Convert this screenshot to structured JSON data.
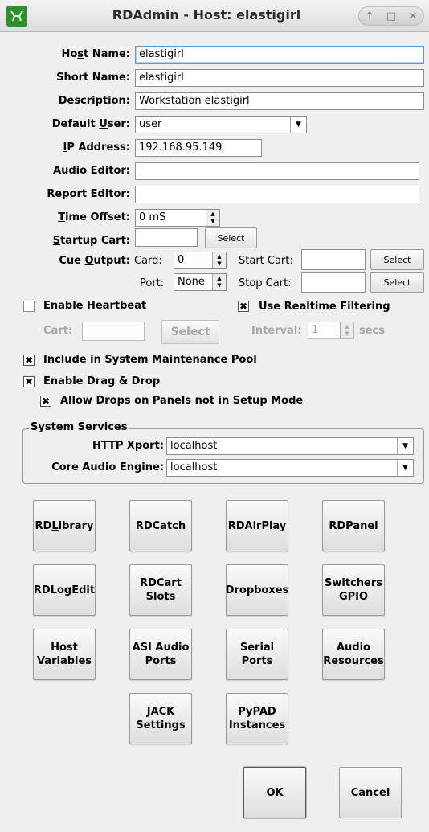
{
  "window": {
    "title": "RDAdmin - Host: elastigirl",
    "app_icon": "rivendell-icon",
    "controls": [
      "↑",
      "□",
      "✕"
    ]
  },
  "form": {
    "host_name": {
      "label": "Host Name:",
      "value": "elastigirl"
    },
    "short_name": {
      "label": "Short Name:",
      "value": "elastigirl"
    },
    "description": {
      "label": "Description:",
      "value": "Workstation elastigirl"
    },
    "default_user": {
      "label": "Default User:",
      "value": "user"
    },
    "ip_address": {
      "label": "IP Address:",
      "value": "192.168.95.149"
    },
    "audio_editor": {
      "label": "Audio Editor:",
      "value": ""
    },
    "report_editor": {
      "label": "Report Editor:",
      "value": ""
    },
    "time_offset": {
      "label": "Time Offset:",
      "value": "0 mS"
    },
    "startup_cart": {
      "label": "Startup Cart:",
      "value": "",
      "button": "Select"
    },
    "cue_output": {
      "label": "Cue Output:",
      "card_label": "Card:",
      "card_value": "0",
      "port_label": "Port:",
      "port_value": "None",
      "start_cart_label": "Start Cart:",
      "start_cart_value": "",
      "start_select": "Select",
      "stop_cart_label": "Stop Cart:",
      "stop_cart_value": "",
      "stop_select": "Select"
    }
  },
  "heartbeat": {
    "enable_label": "Enable Heartbeat",
    "checked": false,
    "cart_label": "Cart:",
    "cart_value": "",
    "select_label": "Select",
    "interval_label": "Interval:",
    "interval_value": "1",
    "secs_label": "secs"
  },
  "realtime_filtering": {
    "label": "Use Realtime Filtering",
    "checked": true
  },
  "maintenance_pool": {
    "label": "Include in System Maintenance Pool",
    "checked": true
  },
  "drag_drop": {
    "label": "Enable Drag & Drop",
    "checked": true
  },
  "allow_drops": {
    "label": "Allow Drops on Panels not in Setup Mode",
    "checked": true
  },
  "system_services": {
    "title": "System Services",
    "http_xport_label": "HTTP Xport:",
    "http_xport_value": "localhost",
    "core_audio_label": "Core Audio Engine:",
    "core_audio_value": "localhost"
  },
  "buttons": {
    "rdlibrary": "RDLibrary",
    "rdcatch": "RDCatch",
    "rdairplay": "RDAirPlay",
    "rdpanel": "RDPanel",
    "rdlogedit": "RDLogEdit",
    "rdcart_slots_1": "RDCart",
    "rdcart_slots_2": "Slots",
    "dropboxes": "Dropboxes",
    "switchers_1": "Switchers",
    "switchers_2": "GPIO",
    "host_variables_1": "Host",
    "host_variables_2": "Variables",
    "asi_1": "ASI Audio",
    "asi_2": "Ports",
    "serial_1": "Serial",
    "serial_2": "Ports",
    "audio_res_1": "Audio",
    "audio_res_2": "Resources",
    "jack_1": "JACK",
    "jack_2": "Settings",
    "pypad_1": "PyPAD",
    "pypad_2": "Instances"
  },
  "dialog": {
    "ok": "OK",
    "cancel": "Cancel"
  }
}
